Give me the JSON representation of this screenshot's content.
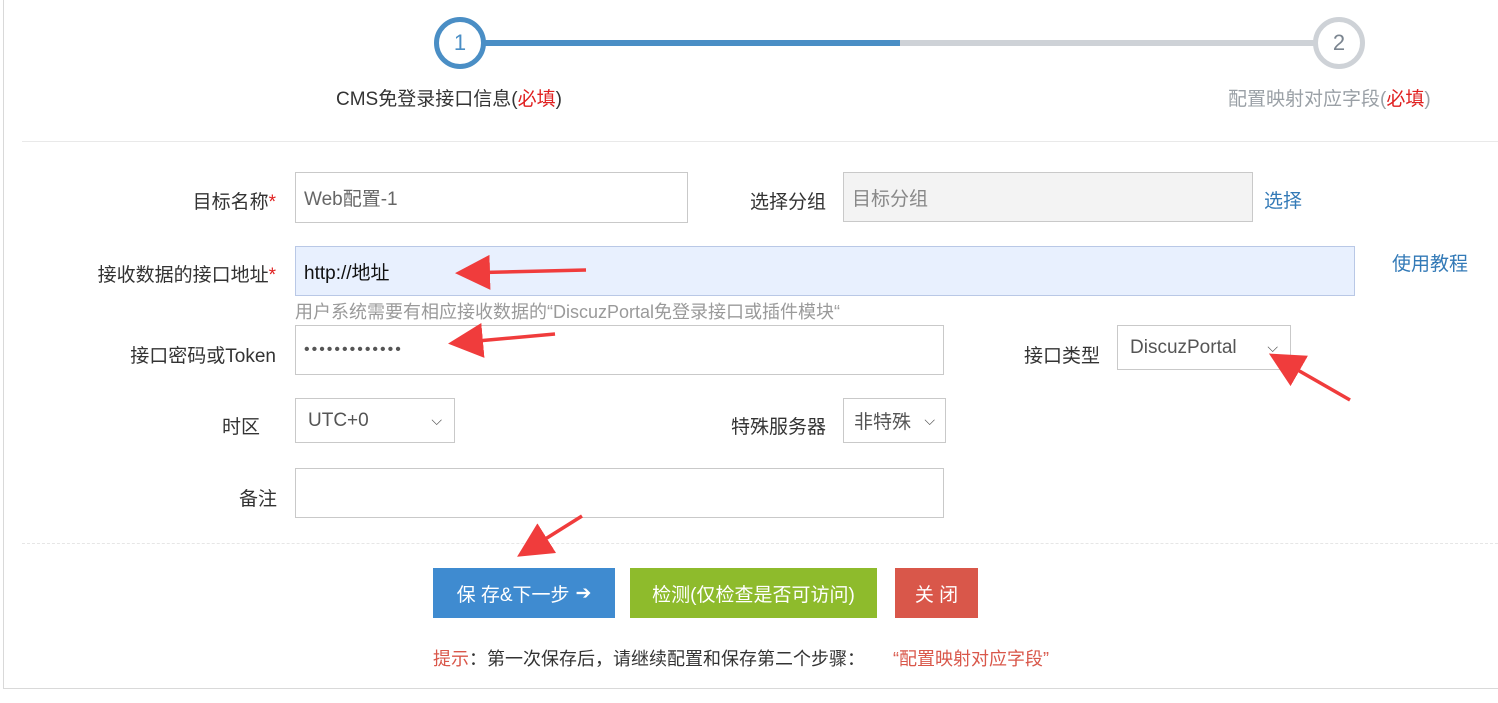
{
  "steps": [
    {
      "number": "1",
      "label": "CMS免登录接口信息(",
      "required": "必填",
      "suffix": ")"
    },
    {
      "number": "2",
      "label": "配置映射对应字段(",
      "required": "必填",
      "suffix": ")"
    }
  ],
  "progress": 0.5,
  "form": {
    "target_name": {
      "label": "目标名称",
      "required": "*",
      "value": "Web配置-1"
    },
    "group": {
      "label": "选择分组",
      "placeholder": "目标分组",
      "link": "选择"
    },
    "endpoint": {
      "label": "接收数据的接口地址",
      "required": "*",
      "value": "http://地址",
      "tutorial": "使用教程",
      "help": "用户系统需要有相应接收数据的“DiscuzPortal免登录接口或插件模块“"
    },
    "token": {
      "label": "接口密码或Token",
      "value": "•••••••••••••"
    },
    "api_type": {
      "label": "接口类型",
      "value": "DiscuzPortal"
    },
    "timezone": {
      "label": "时区",
      "value": "UTC+0"
    },
    "special_server": {
      "label": "特殊服务器",
      "value": "非特殊"
    },
    "remark": {
      "label": "备注",
      "value": ""
    }
  },
  "buttons": {
    "save": "保 存&下一步",
    "check": "检测(仅检查是否可访问)",
    "close": "关 闭"
  },
  "tip": {
    "prefix": "提示",
    "text": "：第一次保存后，请继续配置和保存第二个步骤：",
    "highlight": "“配置映射对应字段”"
  },
  "colors": {
    "accent": "#4a8ec5",
    "required": "#e02020",
    "save": "#3f8bd0",
    "check": "#8ebb2c",
    "close": "#d9574a",
    "annotation_arrow": "#f03c3c"
  }
}
